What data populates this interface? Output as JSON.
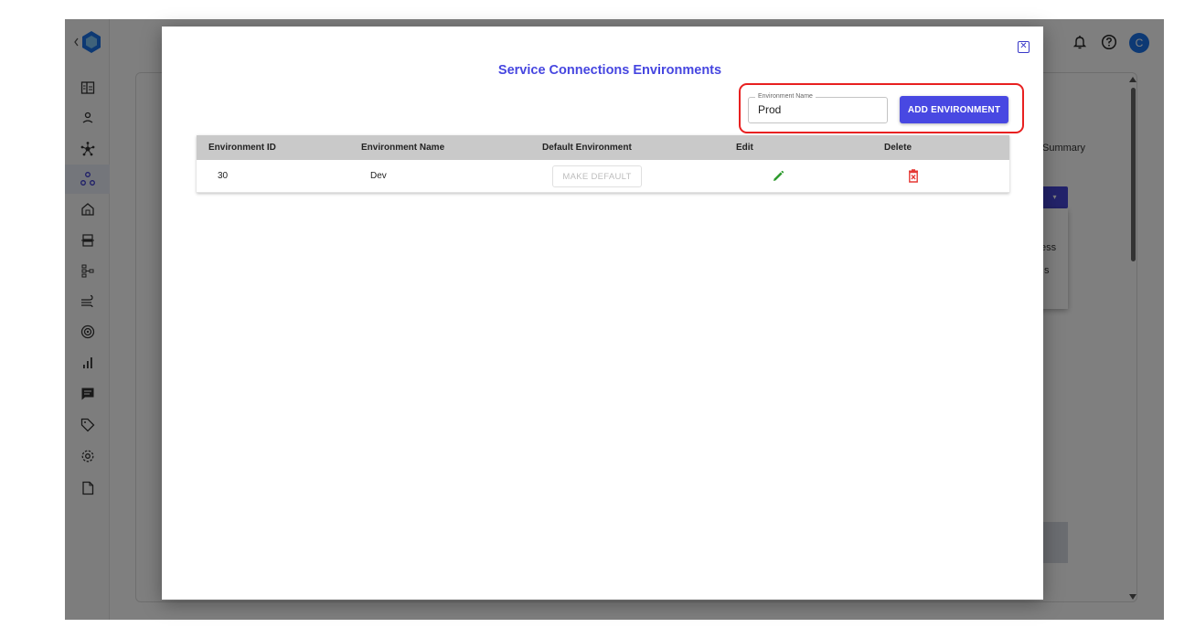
{
  "modal": {
    "title": "Service Connections Environments",
    "close_icon": "close-icon"
  },
  "add_form": {
    "field_label": "Environment Name",
    "field_value": "Prod",
    "add_button_label": "ADD ENVIRONMENT",
    "highlight_color": "#e82020"
  },
  "table": {
    "headers": [
      "Environment ID",
      "Environment Name",
      "Default Environment",
      "Edit",
      "Delete"
    ],
    "rows": [
      {
        "id": "30",
        "name": "Dev",
        "default_button": "MAKE DEFAULT",
        "edit_icon": "pencil-icon",
        "delete_icon": "trash-icon"
      }
    ]
  },
  "background": {
    "summary_text": "Summary",
    "ess_text": "ess",
    "s_text": "s",
    "avatar_letter": "C",
    "topbar_icons": [
      "bell-icon",
      "help-icon",
      "avatar"
    ],
    "sidebar_icons": [
      "dashboard-icon",
      "user-icon",
      "network-icon",
      "connections-icon",
      "home-icon",
      "transfer-icon",
      "hierarchy-icon",
      "wind-icon",
      "target-icon",
      "chart-icon",
      "message-icon",
      "tag-icon",
      "settings-icon",
      "document-icon"
    ]
  },
  "colors": {
    "accent": "#4848e2",
    "title": "#4646e0",
    "edit_green": "#2e9b2e",
    "delete_red": "#e53935",
    "table_header": "#c9c9c9",
    "brand": "#1a73e8"
  }
}
